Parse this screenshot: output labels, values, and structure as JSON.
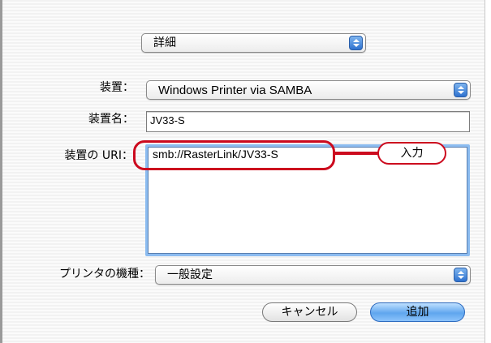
{
  "panel_popup": {
    "value": "詳細"
  },
  "device": {
    "label": "装置：",
    "value": "Windows Printer via SAMBA"
  },
  "device_name": {
    "label": "装置名：",
    "value": "JV33-S"
  },
  "device_uri": {
    "label": "装置の URI：",
    "value": "smb://RasterLink/JV33-S"
  },
  "callout": {
    "text": "入力",
    "color": "#cc0a1e"
  },
  "printer_model": {
    "label": "プリンタの機種：",
    "value": "一般設定"
  },
  "buttons": {
    "cancel": "キャンセル",
    "add": "追加"
  },
  "colors": {
    "accent": "#5fa6ee",
    "focus_ring": "#8cbcf0"
  },
  "icons": {
    "popup_arrows": "up-down-arrows-icon"
  }
}
